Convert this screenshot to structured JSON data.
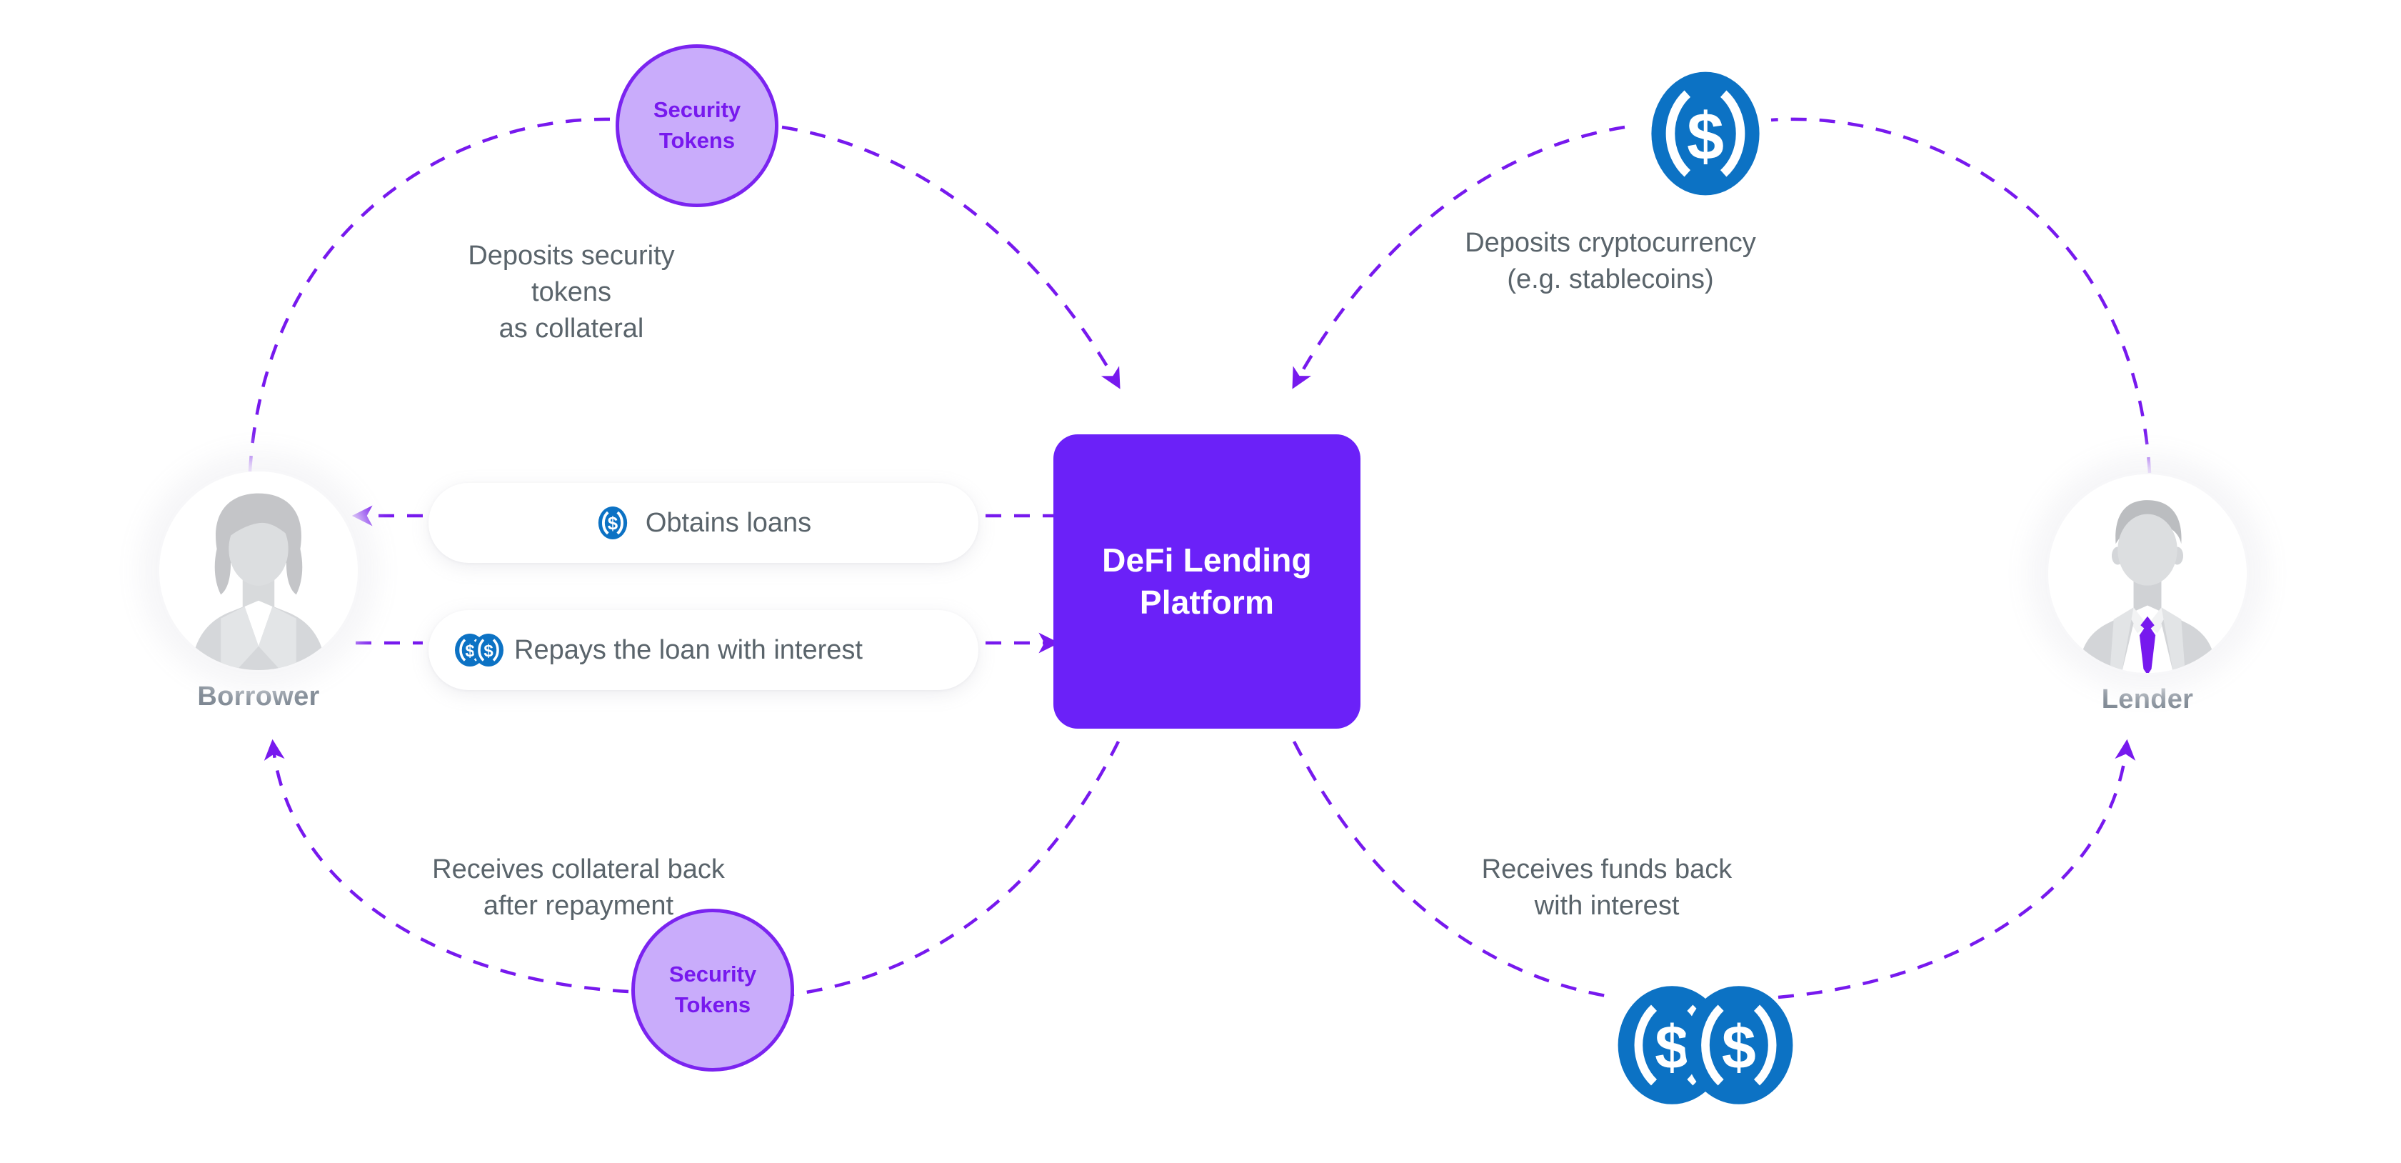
{
  "diagram": {
    "title": "DeFi Lending Platform flow",
    "background_color": "#ffffff"
  },
  "colors": {
    "platform_purple": "#6B21F8",
    "token_fill": "#C9ACFB",
    "token_border": "#7B24F0",
    "token_text": "#7719EE",
    "arrow_purple": "#7719EE",
    "coin_blue": "#0C72C4",
    "caption_gray": "#5A646B",
    "actor_name_gray": "#7D8792"
  },
  "platform": {
    "label": "DeFi Lending\nPlatform"
  },
  "tokens": {
    "top": {
      "label": "Security\nTokens"
    },
    "bottom": {
      "label": "Security\nTokens"
    }
  },
  "actors": {
    "borrower": {
      "name": "Borrower",
      "avatar_icon": "female-avatar-icon"
    },
    "lender": {
      "name": "Lender",
      "avatar_icon": "male-avatar-icon"
    }
  },
  "pills": [
    {
      "id": "obtains-loans",
      "text": "Obtains loans",
      "icon": "single-coin-icon"
    },
    {
      "id": "repays-loan",
      "text": "Repays the loan with interest",
      "icon": "double-coin-icon"
    }
  ],
  "captions": {
    "deposit_tokens": "Deposits security tokens\nas collateral",
    "deposit_crypto": "Deposits cryptocurrency\n(e.g. stablecoins)",
    "collateral_back": "Receives collateral back\nafter repayment",
    "funds_back": "Receives funds back\nwith interest"
  },
  "coin_icons": {
    "top_right": "single-coin-icon",
    "bottom_right": "double-coin-icon"
  },
  "flows": [
    {
      "id": "borrower-deposit-collateral",
      "from": "Borrower",
      "to": "DeFi Lending Platform",
      "label": "Deposits security tokens as collateral",
      "direction": "to-platform"
    },
    {
      "id": "lender-deposit-crypto",
      "from": "Lender",
      "to": "DeFi Lending Platform",
      "label": "Deposits cryptocurrency (e.g. stablecoins)",
      "direction": "to-platform"
    },
    {
      "id": "platform-obtains-loans",
      "from": "DeFi Lending Platform",
      "to": "Borrower",
      "label": "Obtains loans",
      "direction": "to-borrower"
    },
    {
      "id": "borrower-repays",
      "from": "Borrower",
      "to": "DeFi Lending Platform",
      "label": "Repays the loan with interest",
      "direction": "to-platform"
    },
    {
      "id": "platform-collateral-back",
      "from": "DeFi Lending Platform",
      "to": "Borrower",
      "label": "Receives collateral back after repayment",
      "direction": "to-borrower"
    },
    {
      "id": "platform-funds-back",
      "from": "DeFi Lending Platform",
      "to": "Lender",
      "label": "Receives funds back with interest",
      "direction": "to-lender"
    }
  ]
}
